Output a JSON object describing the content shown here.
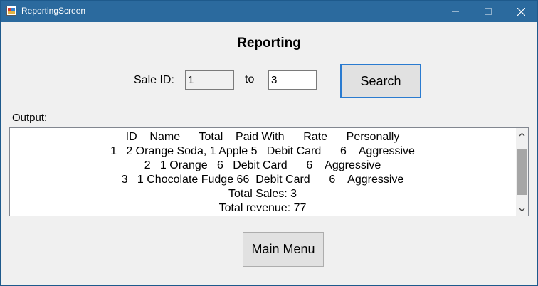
{
  "window": {
    "title": "ReportingScreen",
    "controls": {
      "minimize": "—",
      "maximize": "☐",
      "close": "✕"
    }
  },
  "heading": "Reporting",
  "sale_id": {
    "label": "Sale ID:",
    "from_value": "1",
    "to_label": "to",
    "to_value": "3"
  },
  "search_button": "Search",
  "output": {
    "label": "Output:",
    "lines": [
      "ID    Name      Total    Paid With      Rate      Personally",
      "1   2 Orange Soda, 1 Apple 5   Debit Card      6    Aggressive",
      "2   1 Orange   6   Debit Card      6    Aggressive",
      "3   1 Chocolate Fudge 66  Debit Card      6    Aggressive",
      "Total Sales: 3",
      "Total revenue: 77"
    ]
  },
  "main_menu_button": "Main Menu",
  "colors": {
    "titlebar": "#2b6a9e",
    "focus_border": "#2a7bd0",
    "background": "#f0f0f0"
  }
}
